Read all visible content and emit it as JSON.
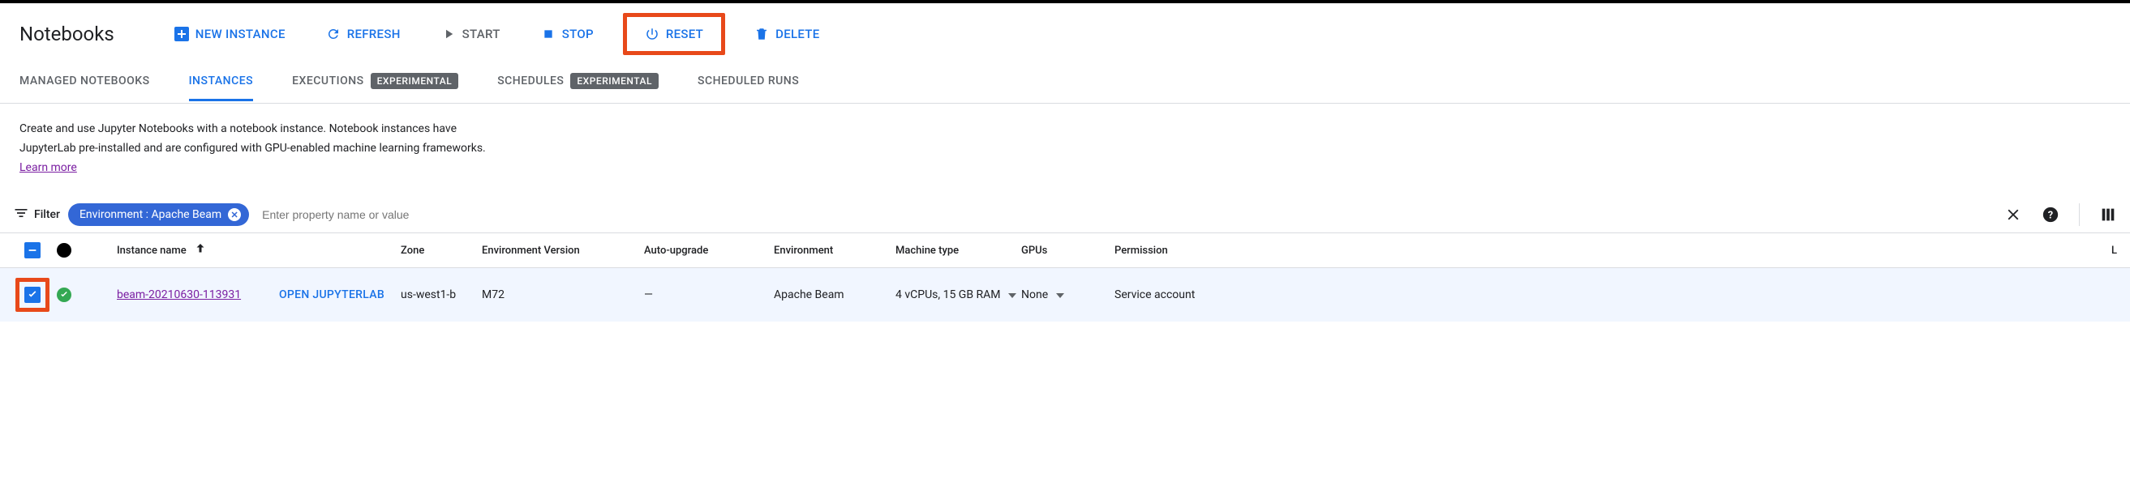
{
  "header": {
    "title": "Notebooks",
    "actions": {
      "new_instance": "NEW INSTANCE",
      "refresh": "REFRESH",
      "start": "START",
      "stop": "STOP",
      "reset": "RESET",
      "delete": "DELETE"
    }
  },
  "tabs": {
    "managed": "MANAGED NOTEBOOKS",
    "instances": "INSTANCES",
    "executions": "EXECUTIONS",
    "schedules": "SCHEDULES",
    "scheduled_runs": "SCHEDULED RUNS",
    "experimental_badge": "EXPERIMENTAL"
  },
  "description": {
    "text": "Create and use Jupyter Notebooks with a notebook instance. Notebook instances have JupyterLab pre-installed and are configured with GPU-enabled machine learning frameworks. ",
    "learn_more": "Learn more"
  },
  "filter": {
    "label": "Filter",
    "chip": "Environment : Apache Beam",
    "placeholder": "Enter property name or value"
  },
  "table": {
    "headers": {
      "name": "Instance name",
      "zone": "Zone",
      "env_version": "Environment Version",
      "auto_upgrade": "Auto-upgrade",
      "environment": "Environment",
      "machine_type": "Machine type",
      "gpus": "GPUs",
      "permission": "Permission",
      "last": "L"
    },
    "row": {
      "name": "beam-20210630-113931",
      "open_jl": "OPEN JUPYTERLAB",
      "zone": "us-west1-b",
      "env_version": "M72",
      "auto_upgrade": "—",
      "environment": "Apache Beam",
      "machine_type": "4 vCPUs, 15 GB RAM",
      "gpus": "None",
      "permission": "Service account"
    }
  }
}
